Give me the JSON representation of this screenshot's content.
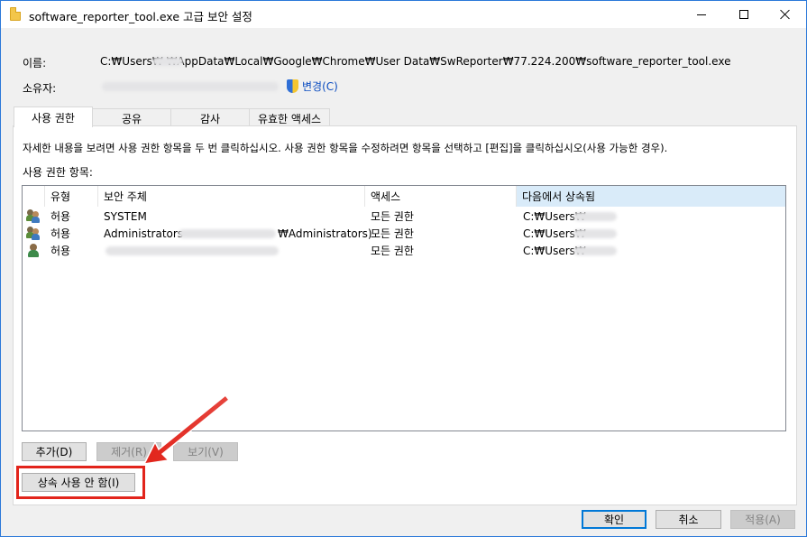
{
  "window": {
    "title": "software_reporter_tool.exe 고급 보안 설정"
  },
  "info": {
    "name_label": "이름:",
    "name_value": "C:₩Users₩         ₩AppData₩Local₩Google₩Chrome₩User Data₩SwReporter₩77.224.200₩software_reporter_tool.exe",
    "owner_label": "소유자:",
    "change_label": "변경(C)"
  },
  "tabs": [
    {
      "label": "사용 권한"
    },
    {
      "label": "공유"
    },
    {
      "label": "감사"
    },
    {
      "label": "유효한 액세스"
    }
  ],
  "description": "자세한 내용을 보려면 사용 권한 항목을 두 번 클릭하십시오. 사용 권한 항목을 수정하려면 항목을 선택하고 [편집]을 클릭하십시오(사용 가능한 경우).",
  "entries_label": "사용 권한 항목:",
  "table": {
    "columns": [
      "유형",
      "보안 주체",
      "액세스",
      "다음에서 상속됨"
    ],
    "rows": [
      {
        "type": "허용",
        "principal": "SYSTEM",
        "access": "모든 권한",
        "inherited": "C:₩Users₩"
      },
      {
        "type": "허용",
        "principal": "Administrators",
        "principal_suffix": "₩Administrators)",
        "access": "모든 권한",
        "inherited": "C:₩Users₩"
      },
      {
        "type": "허용",
        "principal": "",
        "access": "모든 권한",
        "inherited": "C:₩Users₩"
      }
    ]
  },
  "buttons": {
    "add": "추가(D)",
    "remove": "제거(R)",
    "view": "보기(V)",
    "disable_inheritance": "상속 사용 안 함(I)",
    "ok": "확인",
    "cancel": "취소",
    "apply": "적용(A)"
  },
  "colors": {
    "highlight": "#e2241b",
    "accent": "#0078d7"
  }
}
